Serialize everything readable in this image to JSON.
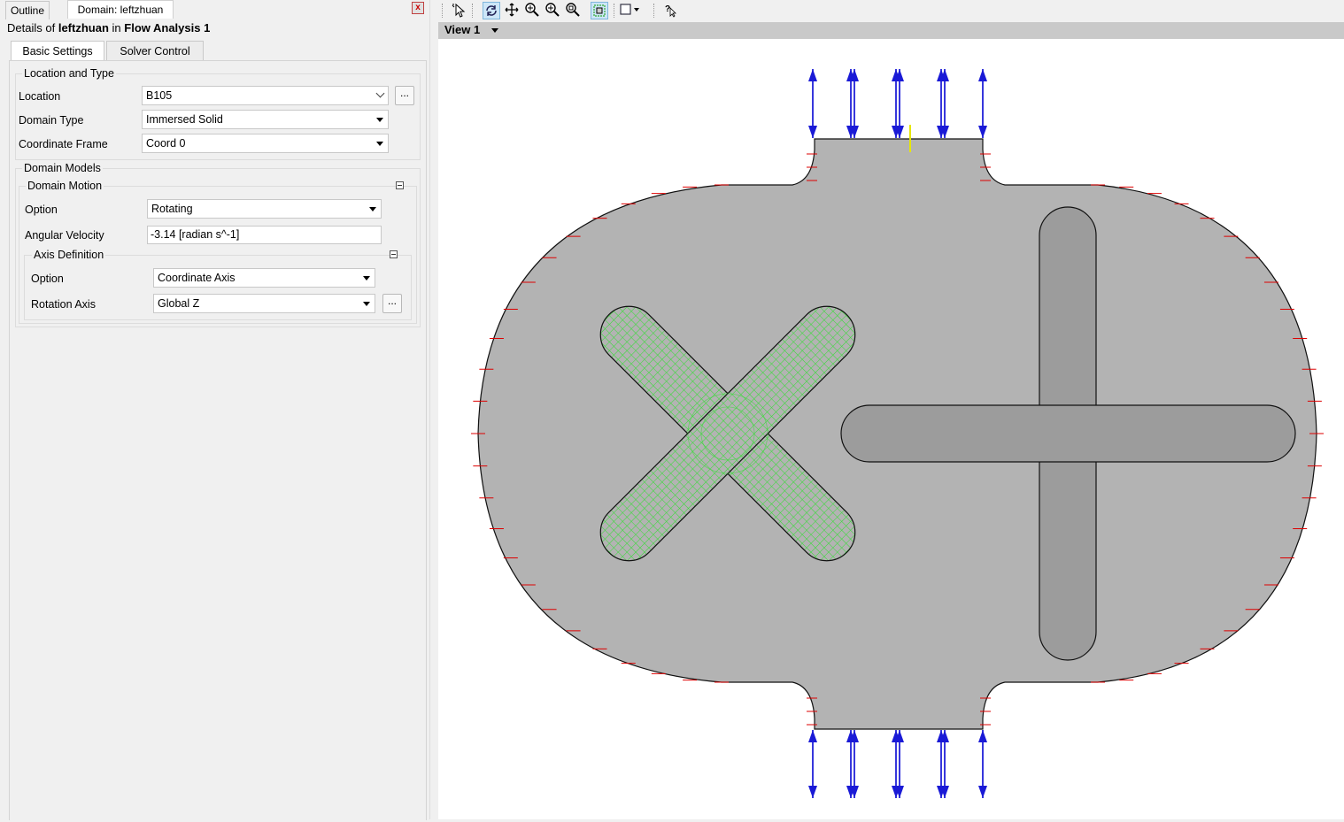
{
  "tabs": {
    "outline": "Outline",
    "domain": "Domain: leftzhuan"
  },
  "details": {
    "prefix": "Details of",
    "object": "leftzhuan",
    "mid": "in",
    "analysis": "Flow Analysis 1"
  },
  "subtabs": {
    "basic": "Basic Settings",
    "solver": "Solver Control"
  },
  "location_and_type": {
    "title": "Location and Type",
    "location": {
      "label": "Location",
      "value": "B105"
    },
    "domain_type": {
      "label": "Domain Type",
      "value": "Immersed Solid"
    },
    "coordinate_frame": {
      "label": "Coordinate Frame",
      "value": "Coord 0"
    }
  },
  "domain_models": {
    "title": "Domain Models",
    "domain_motion": {
      "title": "Domain Motion",
      "option": {
        "label": "Option",
        "value": "Rotating"
      },
      "angular_velocity": {
        "label": "Angular Velocity",
        "value": "-3.14 [radian s^-1]"
      },
      "axis_definition": {
        "title": "Axis Definition",
        "option": {
          "label": "Option",
          "value": "Coordinate Axis"
        },
        "rotation_axis": {
          "label": "Rotation Axis",
          "value": "Global Z"
        }
      }
    }
  },
  "ellipsis": "...",
  "close_label": "x",
  "viewport": {
    "title": "View 1"
  },
  "toolbar_icons": [
    "select-icon",
    "rotate-icon",
    "pan-icon",
    "zoom-icon",
    "zoom-box-icon",
    "zoom-fit-icon",
    "fit-view-icon",
    "viewport-layout-icon",
    "help-icon"
  ],
  "colors": {
    "mesh_green": "#33dd33",
    "boundary_red": "#dd0000",
    "arrow_blue": "#1a1ad6",
    "domain_gray": "#b3b3b3",
    "rotor_gray": "#999999"
  }
}
